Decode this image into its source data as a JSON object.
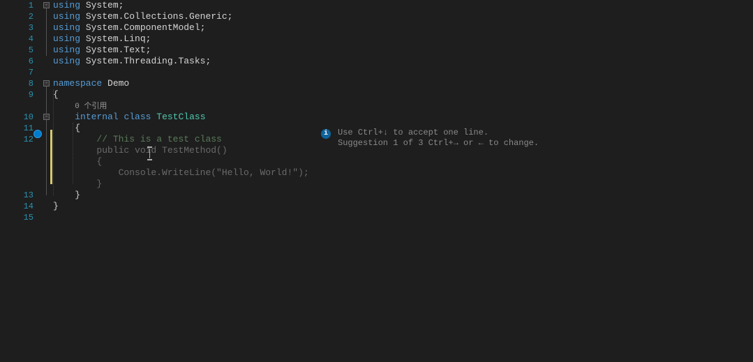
{
  "lines": {
    "l1": {
      "num": "1",
      "using": "using",
      "ns": "System",
      "semi": ";"
    },
    "l2": {
      "num": "2",
      "using": "using",
      "ns": "System.Collections.Generic",
      "semi": ";"
    },
    "l3": {
      "num": "3",
      "using": "using",
      "ns": "System.ComponentModel",
      "semi": ";"
    },
    "l4": {
      "num": "4",
      "using": "using",
      "ns": "System.Linq",
      "semi": ";"
    },
    "l5": {
      "num": "5",
      "using": "using",
      "ns": "System.Text",
      "semi": ";"
    },
    "l6": {
      "num": "6",
      "using": "using",
      "ns": "System.Threading.Tasks",
      "semi": ";"
    },
    "l7": {
      "num": "7"
    },
    "l8": {
      "num": "8",
      "kw": "namespace",
      "name": "Demo"
    },
    "l9": {
      "num": "9",
      "brace": "{"
    },
    "codelens": {
      "text": "0 个引用"
    },
    "l10": {
      "num": "10",
      "mod": "internal",
      "cls": "class",
      "name": "TestClass"
    },
    "l11": {
      "num": "11",
      "brace": "{"
    },
    "l12": {
      "num": "12"
    },
    "ghost": {
      "comment": "// This is a test class",
      "sig": "public void TestMethod()",
      "open": "{",
      "body": "Console.WriteLine(\"Hello, World!\");",
      "close": "}"
    },
    "l13": {
      "num": "13",
      "brace": "}"
    },
    "l14": {
      "num": "14",
      "brace": "}"
    },
    "l15": {
      "num": "15"
    }
  },
  "hint": {
    "line1": "Use Ctrl+↓ to accept one line.",
    "line2": "Suggestion 1 of 3  Ctrl+→ or ← to change."
  },
  "fold": {
    "minus": "-"
  },
  "info_glyph": "i"
}
